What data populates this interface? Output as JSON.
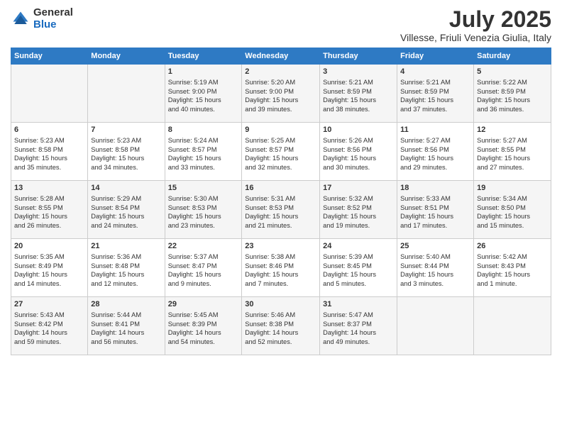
{
  "logo": {
    "general": "General",
    "blue": "Blue"
  },
  "title": "July 2025",
  "location": "Villesse, Friuli Venezia Giulia, Italy",
  "days_header": [
    "Sunday",
    "Monday",
    "Tuesday",
    "Wednesday",
    "Thursday",
    "Friday",
    "Saturday"
  ],
  "weeks": [
    [
      {
        "day": "",
        "lines": []
      },
      {
        "day": "",
        "lines": []
      },
      {
        "day": "1",
        "lines": [
          "Sunrise: 5:19 AM",
          "Sunset: 9:00 PM",
          "Daylight: 15 hours",
          "and 40 minutes."
        ]
      },
      {
        "day": "2",
        "lines": [
          "Sunrise: 5:20 AM",
          "Sunset: 9:00 PM",
          "Daylight: 15 hours",
          "and 39 minutes."
        ]
      },
      {
        "day": "3",
        "lines": [
          "Sunrise: 5:21 AM",
          "Sunset: 8:59 PM",
          "Daylight: 15 hours",
          "and 38 minutes."
        ]
      },
      {
        "day": "4",
        "lines": [
          "Sunrise: 5:21 AM",
          "Sunset: 8:59 PM",
          "Daylight: 15 hours",
          "and 37 minutes."
        ]
      },
      {
        "day": "5",
        "lines": [
          "Sunrise: 5:22 AM",
          "Sunset: 8:59 PM",
          "Daylight: 15 hours",
          "and 36 minutes."
        ]
      }
    ],
    [
      {
        "day": "6",
        "lines": [
          "Sunrise: 5:23 AM",
          "Sunset: 8:58 PM",
          "Daylight: 15 hours",
          "and 35 minutes."
        ]
      },
      {
        "day": "7",
        "lines": [
          "Sunrise: 5:23 AM",
          "Sunset: 8:58 PM",
          "Daylight: 15 hours",
          "and 34 minutes."
        ]
      },
      {
        "day": "8",
        "lines": [
          "Sunrise: 5:24 AM",
          "Sunset: 8:57 PM",
          "Daylight: 15 hours",
          "and 33 minutes."
        ]
      },
      {
        "day": "9",
        "lines": [
          "Sunrise: 5:25 AM",
          "Sunset: 8:57 PM",
          "Daylight: 15 hours",
          "and 32 minutes."
        ]
      },
      {
        "day": "10",
        "lines": [
          "Sunrise: 5:26 AM",
          "Sunset: 8:56 PM",
          "Daylight: 15 hours",
          "and 30 minutes."
        ]
      },
      {
        "day": "11",
        "lines": [
          "Sunrise: 5:27 AM",
          "Sunset: 8:56 PM",
          "Daylight: 15 hours",
          "and 29 minutes."
        ]
      },
      {
        "day": "12",
        "lines": [
          "Sunrise: 5:27 AM",
          "Sunset: 8:55 PM",
          "Daylight: 15 hours",
          "and 27 minutes."
        ]
      }
    ],
    [
      {
        "day": "13",
        "lines": [
          "Sunrise: 5:28 AM",
          "Sunset: 8:55 PM",
          "Daylight: 15 hours",
          "and 26 minutes."
        ]
      },
      {
        "day": "14",
        "lines": [
          "Sunrise: 5:29 AM",
          "Sunset: 8:54 PM",
          "Daylight: 15 hours",
          "and 24 minutes."
        ]
      },
      {
        "day": "15",
        "lines": [
          "Sunrise: 5:30 AM",
          "Sunset: 8:53 PM",
          "Daylight: 15 hours",
          "and 23 minutes."
        ]
      },
      {
        "day": "16",
        "lines": [
          "Sunrise: 5:31 AM",
          "Sunset: 8:53 PM",
          "Daylight: 15 hours",
          "and 21 minutes."
        ]
      },
      {
        "day": "17",
        "lines": [
          "Sunrise: 5:32 AM",
          "Sunset: 8:52 PM",
          "Daylight: 15 hours",
          "and 19 minutes."
        ]
      },
      {
        "day": "18",
        "lines": [
          "Sunrise: 5:33 AM",
          "Sunset: 8:51 PM",
          "Daylight: 15 hours",
          "and 17 minutes."
        ]
      },
      {
        "day": "19",
        "lines": [
          "Sunrise: 5:34 AM",
          "Sunset: 8:50 PM",
          "Daylight: 15 hours",
          "and 15 minutes."
        ]
      }
    ],
    [
      {
        "day": "20",
        "lines": [
          "Sunrise: 5:35 AM",
          "Sunset: 8:49 PM",
          "Daylight: 15 hours",
          "and 14 minutes."
        ]
      },
      {
        "day": "21",
        "lines": [
          "Sunrise: 5:36 AM",
          "Sunset: 8:48 PM",
          "Daylight: 15 hours",
          "and 12 minutes."
        ]
      },
      {
        "day": "22",
        "lines": [
          "Sunrise: 5:37 AM",
          "Sunset: 8:47 PM",
          "Daylight: 15 hours",
          "and 9 minutes."
        ]
      },
      {
        "day": "23",
        "lines": [
          "Sunrise: 5:38 AM",
          "Sunset: 8:46 PM",
          "Daylight: 15 hours",
          "and 7 minutes."
        ]
      },
      {
        "day": "24",
        "lines": [
          "Sunrise: 5:39 AM",
          "Sunset: 8:45 PM",
          "Daylight: 15 hours",
          "and 5 minutes."
        ]
      },
      {
        "day": "25",
        "lines": [
          "Sunrise: 5:40 AM",
          "Sunset: 8:44 PM",
          "Daylight: 15 hours",
          "and 3 minutes."
        ]
      },
      {
        "day": "26",
        "lines": [
          "Sunrise: 5:42 AM",
          "Sunset: 8:43 PM",
          "Daylight: 15 hours",
          "and 1 minute."
        ]
      }
    ],
    [
      {
        "day": "27",
        "lines": [
          "Sunrise: 5:43 AM",
          "Sunset: 8:42 PM",
          "Daylight: 14 hours",
          "and 59 minutes."
        ]
      },
      {
        "day": "28",
        "lines": [
          "Sunrise: 5:44 AM",
          "Sunset: 8:41 PM",
          "Daylight: 14 hours",
          "and 56 minutes."
        ]
      },
      {
        "day": "29",
        "lines": [
          "Sunrise: 5:45 AM",
          "Sunset: 8:39 PM",
          "Daylight: 14 hours",
          "and 54 minutes."
        ]
      },
      {
        "day": "30",
        "lines": [
          "Sunrise: 5:46 AM",
          "Sunset: 8:38 PM",
          "Daylight: 14 hours",
          "and 52 minutes."
        ]
      },
      {
        "day": "31",
        "lines": [
          "Sunrise: 5:47 AM",
          "Sunset: 8:37 PM",
          "Daylight: 14 hours",
          "and 49 minutes."
        ]
      },
      {
        "day": "",
        "lines": []
      },
      {
        "day": "",
        "lines": []
      }
    ]
  ]
}
